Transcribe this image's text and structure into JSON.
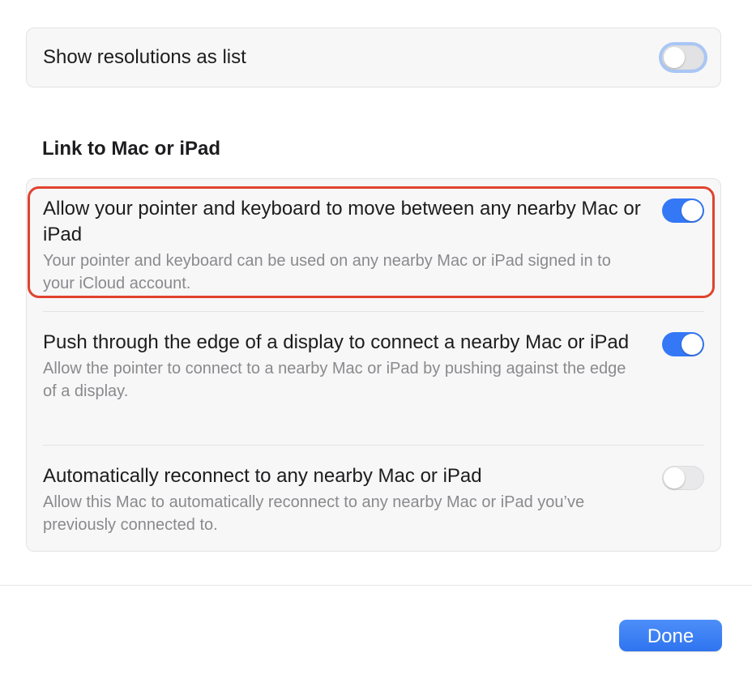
{
  "display_settings": {
    "show_resolutions_label": "Show resolutions as list",
    "show_resolutions_on": false
  },
  "link_section": {
    "heading": "Link to Mac or iPad",
    "items": [
      {
        "title": "Allow your pointer and keyboard to move between any nearby Mac or iPad",
        "description": "Your pointer and keyboard can be used on any nearby Mac or iPad signed in to your iCloud account.",
        "on": true
      },
      {
        "title": "Push through the edge of a display to connect a nearby Mac or iPad",
        "description": "Allow the pointer to connect to a nearby Mac or iPad by pushing against the edge of a display.",
        "on": true
      },
      {
        "title": "Automatically reconnect to any nearby Mac or iPad",
        "description": "Allow this Mac to automatically reconnect to any nearby Mac or iPad you’ve previously connected to.",
        "on": false
      }
    ]
  },
  "footer": {
    "done_label": "Done"
  },
  "colors": {
    "accent": "#3478f6",
    "highlight": "#e0432f"
  }
}
